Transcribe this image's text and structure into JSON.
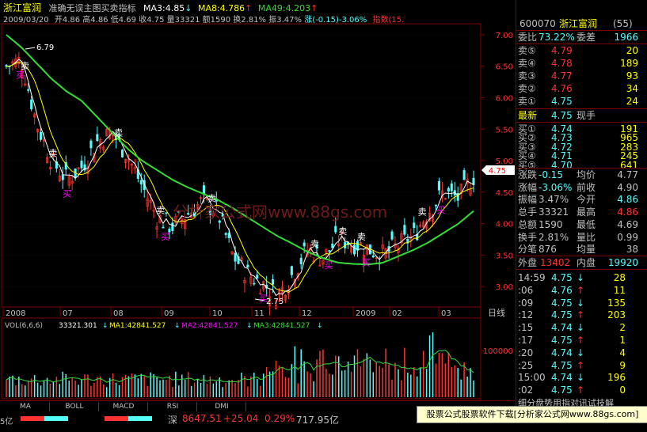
{
  "header": {
    "stock_name": "浙江富润",
    "indicator_name": "准确无误主图买卖指标",
    "ma3": "MA3:4.85",
    "ma8": "MA8:4.786",
    "ma49": "MA49:4.203",
    "date": "2009/03/20",
    "open": "开4.86",
    "high": "高4.86",
    "low": "低4.69",
    "close": "收4.75",
    "volume": "量33321",
    "amount": "额1590",
    "turnover": "换2.81%",
    "amplitude": "振3.47%",
    "change": "涨(-0.15)-3.06%",
    "index_label": "指数(15."
  },
  "price_axis": {
    "ticks": [
      "7.00",
      "6.50",
      "6.00",
      "5.50",
      "5.00",
      "4.50",
      "4.00",
      "3.50",
      "3.00"
    ],
    "current_price_tag": "4.75"
  },
  "annotations": {
    "high_label": "6.79",
    "low_label": "2.75",
    "buy": "买",
    "sell": "卖",
    "watermark": "分析家公式网www.88gs.com"
  },
  "chart_data": {
    "type": "line",
    "x": [
      "2008",
      "07",
      "08",
      "09",
      "10",
      "11",
      "12",
      "2009",
      "02",
      "03"
    ],
    "series": [
      {
        "name": "MA49",
        "values": [
          7.0,
          6.8,
          6.55,
          6.3,
          6.1,
          5.95,
          5.7,
          5.45,
          5.2,
          5.0,
          4.85,
          4.7,
          4.58,
          4.48,
          4.38,
          4.25,
          4.1,
          3.95,
          3.8,
          3.68,
          3.55,
          3.45,
          3.38,
          3.36,
          3.35,
          3.38,
          3.48,
          3.58,
          3.7,
          3.85,
          4.0,
          4.2
        ]
      },
      {
        "name": "close",
        "values": [
          6.5,
          6.6,
          5.6,
          5.0,
          4.7,
          4.9,
          5.3,
          5.45,
          5.1,
          4.6,
          4.1,
          3.95,
          4.15,
          4.35,
          4.2,
          3.5,
          3.2,
          3.05,
          2.85,
          3.2,
          3.6,
          3.45,
          3.75,
          3.7,
          3.6,
          3.5,
          3.65,
          3.8,
          4.2,
          4.5,
          4.4,
          4.75
        ]
      }
    ],
    "ylim": [
      2.7,
      7.1
    ]
  },
  "timeline": {
    "labels": [
      "2008",
      "07",
      "08",
      "09",
      "10",
      "11",
      "12",
      "2009",
      "02",
      "03"
    ],
    "right_label": "日线"
  },
  "volume_header": {
    "vol": "VOL(6,6,6)",
    "vol_value": "33321.301",
    "ma1": "MA1:42841.527",
    "ma2": "MA2:42841.527",
    "ma3": "MA3:42841.527",
    "axis_tick": "100000"
  },
  "tabs": [
    "MA",
    "BOLL",
    "MACD",
    "RSI",
    "DMI"
  ],
  "right_panel": {
    "code": "600070",
    "name": "浙江富润",
    "code_suffix": "(55)",
    "weibi_label": "委比",
    "weibi_value": "73.22%",
    "weicha_label": "委差",
    "weicha_value": "1966",
    "sell": [
      {
        "label": "卖⑤",
        "price": "4.79",
        "vol": "20"
      },
      {
        "label": "卖④",
        "price": "4.78",
        "vol": "189"
      },
      {
        "label": "卖③",
        "price": "4.77",
        "vol": "93"
      },
      {
        "label": "卖②",
        "price": "4.76",
        "vol": "34"
      },
      {
        "label": "卖①",
        "price": "4.75",
        "vol": "24"
      }
    ],
    "latest_label": "最新",
    "latest_price": "4.75",
    "xianshou": "现手",
    "buy": [
      {
        "label": "买①",
        "price": "4.74",
        "vol": "191"
      },
      {
        "label": "买②",
        "price": "4.73",
        "vol": "965"
      },
      {
        "label": "买③",
        "price": "4.72",
        "vol": "283"
      },
      {
        "label": "买④",
        "price": "4.71",
        "vol": "245"
      },
      {
        "label": "买⑤",
        "price": "4.70",
        "vol": "641"
      }
    ],
    "stats": [
      {
        "l1": "涨跌",
        "v1": "-0.15",
        "l2": "均价",
        "v2": "4.77"
      },
      {
        "l1": "涨幅",
        "v1": "-3.06%",
        "l2": "前收",
        "v2": "4.90"
      },
      {
        "l1": "振幅",
        "v1": "3.47%",
        "l2": "今开",
        "v2": "4.86"
      },
      {
        "l1": "总手",
        "v1": "33321",
        "l2": "最高",
        "v2": "4.86"
      },
      {
        "l1": "总额",
        "v1": "1590",
        "l2": "最低",
        "v2": "4.69"
      },
      {
        "l1": "换手",
        "v1": "2.81%",
        "l2": "量比",
        "v2": "0.99"
      },
      {
        "l1": "分笔",
        "v1": "876",
        "l2": "均量",
        "v2": "38"
      }
    ],
    "waipan_label": "外盘",
    "waipan_value": "13402",
    "neipan_label": "内盘",
    "neipan_value": "19920",
    "ticks": [
      {
        "time": "14:59",
        "price": "4.75",
        "dir": "↓",
        "vol": "28"
      },
      {
        "time": ":06",
        "price": "4.76",
        "dir": "↑",
        "vol": "11"
      },
      {
        "time": ":09",
        "price": "4.75",
        "dir": "↓",
        "vol": "135"
      },
      {
        "time": ":12",
        "price": "4.75",
        "dir": "↑",
        "vol": "203"
      },
      {
        "time": ":15",
        "price": "4.74",
        "dir": "↓",
        "vol": "2"
      },
      {
        "time": ":17",
        "price": "4.75",
        "dir": "↑",
        "vol": "1"
      },
      {
        "time": ":20",
        "price": "4.74",
        "dir": "↓",
        "vol": "4"
      },
      {
        "time": ":25",
        "price": "4.75",
        "dir": "↑",
        "vol": "9"
      },
      {
        "time": "15:00",
        "price": "4.74",
        "dir": "↓",
        "vol": "196"
      },
      {
        "time": ":02",
        "price": "4.75",
        "dir": "↑",
        "vol": "0"
      }
    ],
    "footer": "细分盘势用指对讯试技解"
  },
  "status": {
    "left_label": "5亿",
    "market": "深",
    "index_value": "8647.51",
    "index_change": "+25.04",
    "index_pct": "0.29%",
    "index_amount": "717.95亿"
  },
  "ad": "股票公式股票软件下载[分析家公式网www.88gs.com]",
  "colors": {
    "up": "#ff3232",
    "down": "#54fcfc",
    "ma49": "#33dd33",
    "label_yellow": "#ffff00",
    "border": "#800000"
  }
}
